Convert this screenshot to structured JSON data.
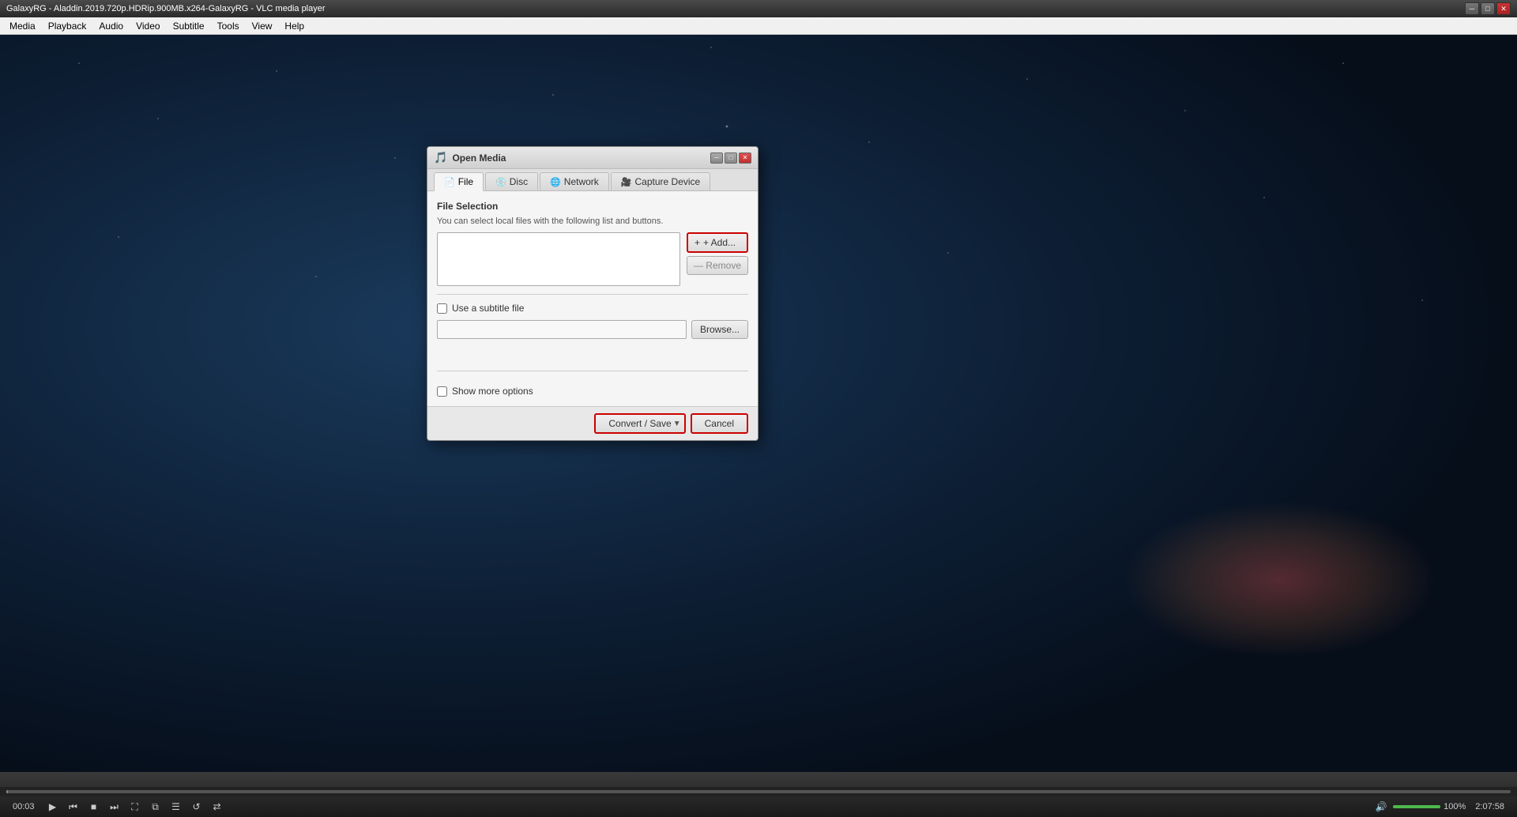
{
  "titlebar": {
    "title": "GalaxyRG - Aladdin.2019.720p.HDRip.900MB.x264-GalaxyRG - VLC media player",
    "minimize_label": "─",
    "restore_label": "□",
    "close_label": "✕"
  },
  "menubar": {
    "items": [
      "Media",
      "Playback",
      "Audio",
      "Video",
      "Subtitle",
      "Tools",
      "View",
      "Help"
    ]
  },
  "dialog": {
    "title": "Open Media",
    "icon": "▶",
    "controls": {
      "minimize": "─",
      "restore": "□",
      "close": "✕"
    },
    "tabs": [
      {
        "id": "file",
        "label": "File",
        "icon": "📄",
        "active": true
      },
      {
        "id": "disc",
        "label": "Disc",
        "icon": "💿",
        "active": false
      },
      {
        "id": "network",
        "label": "Network",
        "icon": "🌐",
        "active": false
      },
      {
        "id": "capture",
        "label": "Capture Device",
        "icon": "🎥",
        "active": false
      }
    ],
    "content": {
      "section_title": "File Selection",
      "section_desc": "You can select local files with the following list and buttons.",
      "add_btn": "+ Add...",
      "remove_btn": "— Remove",
      "subtitle_checkbox_label": "Use a subtitle file",
      "subtitle_placeholder": "",
      "browse_btn": "Browse...",
      "show_more_label": "Show more options"
    },
    "footer": {
      "convert_btn": "Convert / Save",
      "cancel_btn": "Cancel",
      "arrow": "▼"
    }
  },
  "bottombar": {
    "time_current": "00:03",
    "time_total": "2:07:58",
    "volume_pct": "100%",
    "controls": {
      "play": "▶",
      "prev": "⏮",
      "stop": "■",
      "next": "⏭",
      "fullscreen": "⛶",
      "extended": "⧉",
      "playlist": "☰",
      "loop": "↺",
      "random": "⇄",
      "mute": "🔊"
    }
  }
}
